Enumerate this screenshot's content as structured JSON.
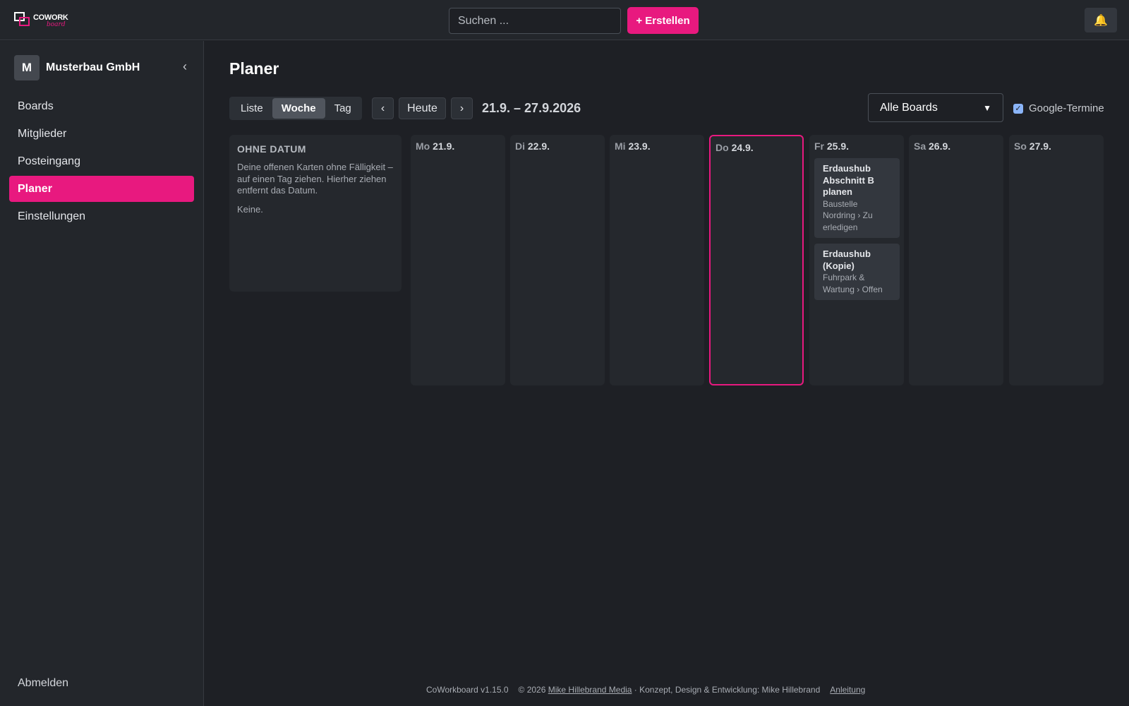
{
  "app": {
    "logo_text": "COWORK",
    "logo_sub": "board"
  },
  "topbar": {
    "search_placeholder": "Suchen ...",
    "create_label": "+ Erstellen",
    "bell_icon": "bell-icon"
  },
  "sidebar": {
    "org_initial": "M",
    "org_name": "Musterbau GmbH",
    "collapse_glyph": "‹",
    "items": [
      {
        "label": "Boards"
      },
      {
        "label": "Mitglieder"
      },
      {
        "label": "Posteingang"
      },
      {
        "label": "Planer",
        "active": true
      },
      {
        "label": "Einstellungen"
      }
    ],
    "logout_label": "Abmelden"
  },
  "main": {
    "title": "Planer",
    "views": [
      "Liste",
      "Woche",
      "Tag"
    ],
    "active_view": "Woche",
    "prev_glyph": "‹",
    "today_label": "Heute",
    "next_glyph": "›",
    "range": "21.9. – 27.9.2026",
    "board_filter": "Alle Boards",
    "google_label": "Google-Termine",
    "google_checked": true
  },
  "no_date": {
    "title": "OHNE DATUM",
    "description": "Deine offenen Karten ohne Fälligkeit – auf einen Tag ziehen. Hierher ziehen entfernt das Datum.",
    "empty": "Keine."
  },
  "days": [
    {
      "dow": "Mo",
      "date": "21.9.",
      "cards": []
    },
    {
      "dow": "Di",
      "date": "22.9.",
      "cards": []
    },
    {
      "dow": "Mi",
      "date": "23.9.",
      "cards": []
    },
    {
      "dow": "Do",
      "date": "24.9.",
      "today": true,
      "cards": []
    },
    {
      "dow": "Fr",
      "date": "25.9.",
      "cards": [
        {
          "title": "Erdaushub Abschnitt B planen",
          "sub": "Baustelle Nordring › Zu erledigen"
        },
        {
          "title": "Erdaushub (Kopie)",
          "sub": "Fuhrpark & Wartung › Offen"
        }
      ]
    },
    {
      "dow": "Sa",
      "date": "26.9.",
      "cards": []
    },
    {
      "dow": "So",
      "date": "27.9.",
      "cards": []
    }
  ],
  "footer": {
    "version": "CoWorkboard v1.15.0",
    "copyright": "© 2026",
    "company_link": "Mike Hillebrand Media",
    "credits": "· Konzept, Design & Entwicklung: Mike Hillebrand",
    "guide_link": "Anleitung"
  },
  "colors": {
    "accent": "#e8197f",
    "background": "#1e2025",
    "panel": "#23262b"
  }
}
